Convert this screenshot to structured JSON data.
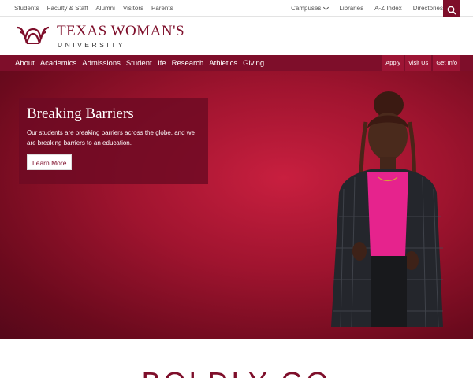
{
  "utility": {
    "left_links": [
      "Students",
      "Faculty & Staff",
      "Alumni",
      "Visitors",
      "Parents"
    ],
    "right_links": [
      "Campuses",
      "Libraries",
      "A-Z Index",
      "Directories"
    ],
    "search_icon": "search-icon"
  },
  "brand": {
    "line1": "TEXAS WOMAN'S",
    "line2": "UNIVERSITY",
    "color": "#7e0e2a"
  },
  "nav": {
    "items": [
      "About",
      "Academics",
      "Admissions",
      "Student Life",
      "Research",
      "Athletics",
      "Giving"
    ],
    "actions": [
      "Apply",
      "Visit Us",
      "Get Info"
    ]
  },
  "hero": {
    "title": "Breaking Barriers",
    "text": "Our students are breaking barriers across the globe, and we are breaking barriers to an education.",
    "button": "Learn More"
  },
  "below": {
    "heading": "BOLDLY GO"
  }
}
